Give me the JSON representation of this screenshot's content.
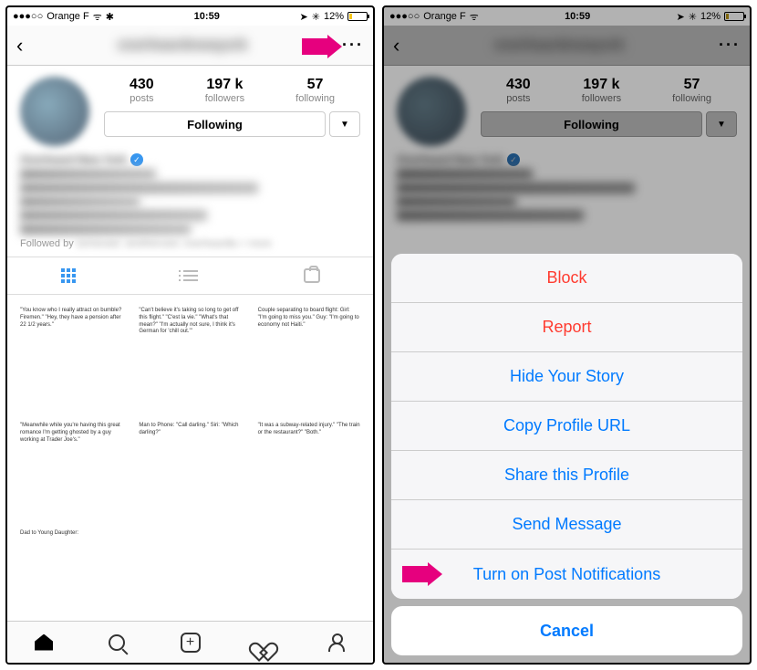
{
  "status": {
    "carrier": "Orange F",
    "time": "10:59",
    "battery_pct": "12%"
  },
  "profile": {
    "username": "overheardnewyork",
    "display_name": "Overheard New York",
    "stats": {
      "posts": {
        "value": "430",
        "label": "posts"
      },
      "followers": {
        "value": "197 k",
        "label": "followers"
      },
      "following": {
        "value": "57",
        "label": "following"
      }
    },
    "follow_button": "Following",
    "followed_by_prefix": "Followed by",
    "followed_by_blur": "someuser, anotheruser, overheardla + more"
  },
  "posts": [
    "\"You know who I really attract on bumble? Firemen.\"\n\"Hey, they have a pension after 22 1/2 years.\"",
    "\"Can't believe it's taking so long to get off this flight.\"\n\"C'est la vie.\"\n\"What's that mean?\"\n\"I'm actually not sure, I think it's German for 'chill out.'\"",
    "Couple separating to board flight:\nGirl: \"I'm going to miss you.\"\nGuy: \"I'm going to economy not Haiti.\"",
    "\"Meanwhile while you're having this great romance I'm getting ghosted by a guy working at Trader Joe's.\"",
    "Man to Phone: \"Call darling.\"\nSiri: \"Which darling?\"",
    "\"It was a subway-related injury.\"\n\"The train or the restaurant?\"\n\"Both.\"",
    "Dad to Young Daughter:",
    "",
    ""
  ],
  "action_sheet": {
    "items": [
      {
        "label": "Block",
        "style": "red"
      },
      {
        "label": "Report",
        "style": "red"
      },
      {
        "label": "Hide Your Story",
        "style": "blue"
      },
      {
        "label": "Copy Profile URL",
        "style": "blue"
      },
      {
        "label": "Share this Profile",
        "style": "blue"
      },
      {
        "label": "Send Message",
        "style": "blue"
      },
      {
        "label": "Turn on Post Notifications",
        "style": "blue"
      }
    ],
    "cancel": "Cancel"
  },
  "pointer_color": "#e6007e"
}
